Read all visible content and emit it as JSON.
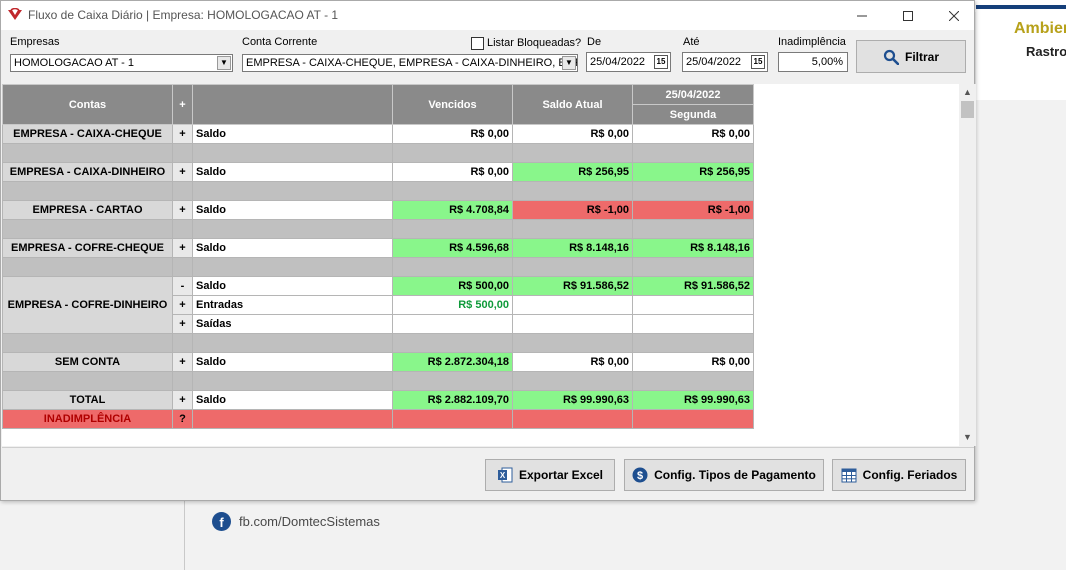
{
  "window": {
    "title": "Fluxo de Caixa Diário | Empresa: HOMOLOGACAO AT - 1"
  },
  "filters": {
    "empresas_label": "Empresas",
    "empresas_value": "HOMOLOGACAO AT - 1",
    "conta_label": "Conta Corrente",
    "conta_value": "EMPRESA - CAIXA-CHEQUE, EMPRESA - CAIXA-DINHEIRO, EMPR",
    "bloqueadas_label": "Listar Bloqueadas?",
    "de_label": "De",
    "de_value": "25/04/2022",
    "ate_label": "Até",
    "ate_value": "25/04/2022",
    "inad_label": "Inadimplência",
    "inad_value": "5,00%",
    "filtrar_label": "Filtrar"
  },
  "grid": {
    "headers": {
      "contas": "Contas",
      "plus": "+",
      "vencidos": "Vencidos",
      "saldo_atual": "Saldo Atual",
      "date": "25/04/2022",
      "weekday": "Segunda"
    },
    "rows": [
      {
        "account": "EMPRESA - CAIXA-CHEQUE",
        "pm": "+",
        "label": "Saldo",
        "vencidos": "R$ 0,00",
        "saldo_atual": "R$ 0,00",
        "day": "R$ 0,00"
      },
      {
        "account": "EMPRESA - CAIXA-DINHEIRO",
        "pm": "+",
        "label": "Saldo",
        "vencidos": "R$ 0,00",
        "saldo_atual": "R$ 256,95",
        "day": "R$ 256,95"
      },
      {
        "account": "EMPRESA - CARTAO",
        "pm": "+",
        "label": "Saldo",
        "vencidos": "R$ 4.708,84",
        "saldo_atual": "R$ -1,00",
        "day": "R$ -1,00"
      },
      {
        "account": "EMPRESA - COFRE-CHEQUE",
        "pm": "+",
        "label": "Saldo",
        "vencidos": "R$ 4.596,68",
        "saldo_atual": "R$ 8.148,16",
        "day": "R$ 8.148,16"
      },
      {
        "account": "EMPRESA - COFRE-DINHEIRO",
        "pm": "-",
        "label": "Saldo",
        "vencidos": "R$ 500,00",
        "saldo_atual": "R$ 91.586,52",
        "day": "R$ 91.586,52",
        "sub": [
          {
            "pm": "+",
            "label": "Entradas",
            "vencidos": "R$ 500,00"
          },
          {
            "pm": "+",
            "label": "Saídas"
          }
        ]
      },
      {
        "account": "SEM CONTA",
        "pm": "+",
        "label": "Saldo",
        "vencidos": "R$ 2.872.304,18",
        "saldo_atual": "R$ 0,00",
        "day": "R$ 0,00"
      },
      {
        "account": "TOTAL",
        "pm": "+",
        "label": "Saldo",
        "vencidos": "R$ 2.882.109,70",
        "saldo_atual": "R$ 99.990,63",
        "day": "R$ 99.990,63"
      },
      {
        "account": "INADIMPLÊNCIA",
        "pm": "?"
      }
    ]
  },
  "footer": {
    "excel_label": "Exportar Excel",
    "tipos_label": "Config. Tipos de Pagamento",
    "feriados_label": "Config. Feriados"
  },
  "background": {
    "banner_title": "Ambier",
    "banner_sub": "Rastro",
    "facebook": "fb.com/DomtecSistemas"
  },
  "colors": {
    "positive": "#89f68b",
    "negative": "#ee6a6a",
    "header": "#8a8a8a"
  }
}
